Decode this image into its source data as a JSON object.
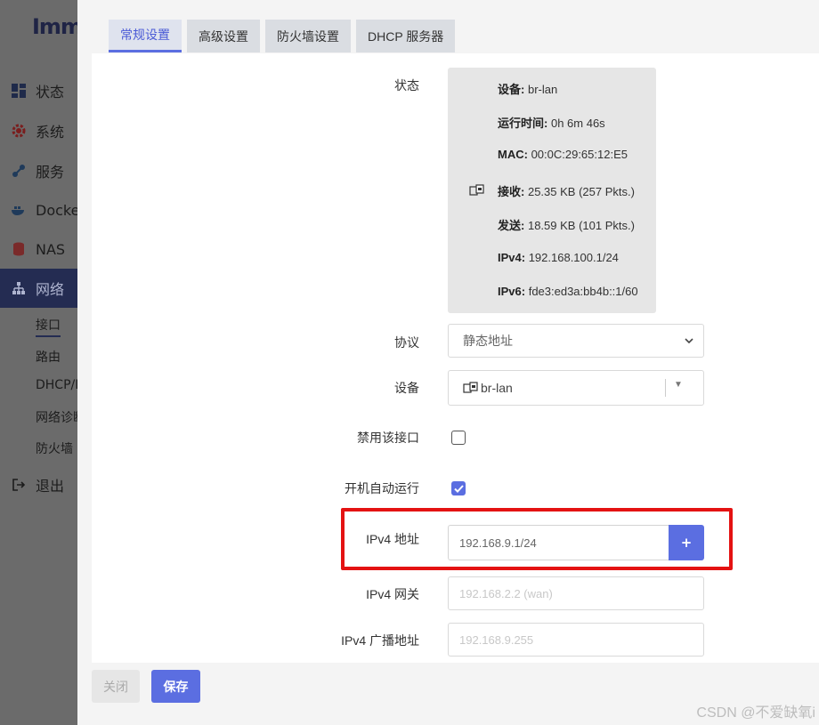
{
  "sidebar": {
    "logo": "Imm",
    "menu": [
      {
        "label": "状态"
      },
      {
        "label": "系统"
      },
      {
        "label": "服务"
      },
      {
        "label": "Docke"
      },
      {
        "label": "NAS"
      },
      {
        "label": "网络"
      }
    ],
    "network_sub": [
      "接口",
      "路由",
      "DHCP/D",
      "网络诊断",
      "防火墙"
    ],
    "logout": "退出"
  },
  "tabs": [
    "常规设置",
    "高级设置",
    "防火墙设置",
    "DHCP 服务器"
  ],
  "status": {
    "label": "状态",
    "device_key": "设备:",
    "device_val": "br-lan",
    "uptime_key": "运行时间:",
    "uptime_val": "0h 6m 46s",
    "mac_key": "MAC:",
    "mac_val": "00:0C:29:65:12:E5",
    "rx_key": "接收:",
    "rx_val": "25.35 KB (257 Pkts.)",
    "tx_key": "发送:",
    "tx_val": "18.59 KB (101 Pkts.)",
    "ipv4_key": "IPv4:",
    "ipv4_val": "192.168.100.1/24",
    "ipv6_key": "IPv6:",
    "ipv6_val": "fde3:ed3a:bb4b::1/60"
  },
  "form": {
    "protocol_label": "协议",
    "protocol_value": "静态地址",
    "device_label": "设备",
    "device_value": "br-lan",
    "disable_label": "禁用该接口",
    "disable_checked": false,
    "autostart_label": "开机自动运行",
    "autostart_checked": true,
    "ipv4_addr_label": "IPv4 地址",
    "ipv4_addr_value": "192.168.9.1/24",
    "add_symbol": "+",
    "ipv4_gw_label": "IPv4 网关",
    "ipv4_gw_placeholder": "192.168.2.2 (wan)",
    "ipv4_bcast_label": "IPv4 广播地址",
    "ipv4_bcast_placeholder": "192.168.9.255"
  },
  "footer": {
    "close": "关闭",
    "save": "保存"
  },
  "watermark": "CSDN @不爱缺氧i",
  "colors": {
    "accent": "#5b6ee1",
    "highlight": "#e41212",
    "sidebar_active": "#242c52"
  }
}
